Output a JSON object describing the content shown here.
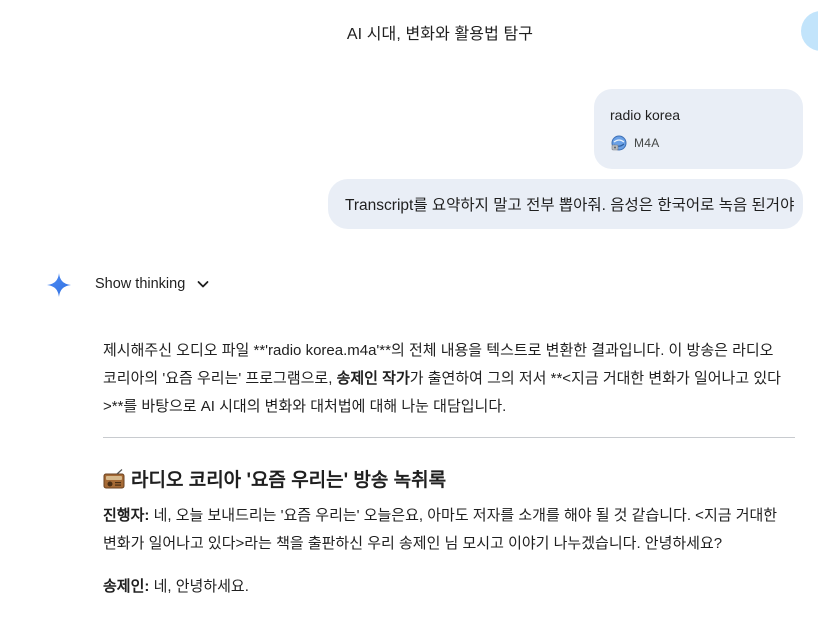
{
  "header": {
    "title": "AI 시대, 변화와 활용법 탐구"
  },
  "attachment": {
    "file_name": "radio korea",
    "file_type": "M4A",
    "icon": "audio-file-icon"
  },
  "user_message": {
    "text": "Transcript를 요약하지 말고 전부 뽑아줘. 음성은 한국어로 녹음 된거야"
  },
  "thinking": {
    "label": "Show thinking",
    "icon": "chevron-down-icon"
  },
  "response": {
    "intro_line1": "제시해주신 오디오 파일 **'radio korea.m4a'**의 전체 내용을 텍스트로 변환한 결과입니다. 이 방송은 라디오",
    "intro_line2_a": "코리아의 '요즘 우리는' 프로그램으로, ",
    "intro_line2_bold": "송제인 작가",
    "intro_line2_b": "가 출연하여 그의 저서 **<지금 거대한 변화가 일어나고 있다",
    "intro_line3": ">**를 바탕으로 AI 시대의 변화와 대처법에 대해 나눈 대담입니다.",
    "heading": "라디오 코리아 '요즘 우리는' 방송 녹취록",
    "transcript": [
      {
        "speaker": "진행자:",
        "line1": " 네, 오늘 보내드리는 '요즘 우리는' 오늘은요, 아마도 저자를 소개를 해야 될 것 같습니다. <지금 거대한",
        "line2": "변화가 일어나고 있다>라는 책을 출판하신 우리 송제인 님 모시고 이야기 나누겠습니다. 안녕하세요?"
      },
      {
        "speaker": "송제인:",
        "line1": " 네, 안녕하세요."
      }
    ]
  },
  "colors": {
    "bubble": "#e9eef6",
    "accent": "#4285f4",
    "avatar": "#c2e4fb"
  }
}
